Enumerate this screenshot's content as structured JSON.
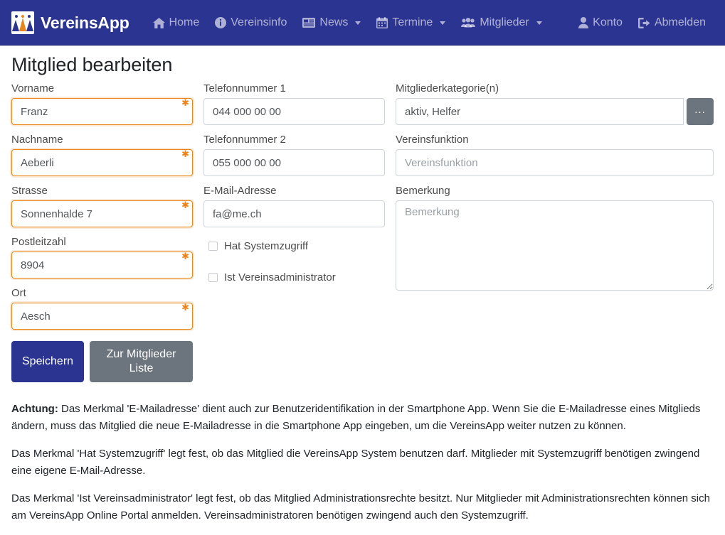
{
  "navbar": {
    "brand": "VereinsApp",
    "brand_icon": "vereinsapp-logo-icon",
    "items": [
      {
        "label": "Home",
        "icon": "home-icon",
        "caret": false
      },
      {
        "label": "Vereinsinfo",
        "icon": "info-circle-icon",
        "caret": false
      },
      {
        "label": "News",
        "icon": "newspaper-icon",
        "caret": true
      },
      {
        "label": "Termine",
        "icon": "calendar-icon",
        "caret": true
      },
      {
        "label": "Mitglieder",
        "icon": "users-icon",
        "caret": true
      }
    ],
    "right": [
      {
        "label": "Konto",
        "icon": "user-icon"
      },
      {
        "label": "Abmelden",
        "icon": "sign-out-icon"
      }
    ],
    "bg_color": "#2b3490"
  },
  "page": {
    "title": "Mitglied bearbeiten"
  },
  "form": {
    "required_marker": "✱",
    "column_left": [
      {
        "label": "Vorname",
        "value": "Franz",
        "required": true
      },
      {
        "label": "Nachname",
        "value": "Aeberli",
        "required": true
      },
      {
        "label": "Strasse",
        "value": "Sonnenhalde 7",
        "required": true
      },
      {
        "label": "Postleitzahl",
        "value": "8904",
        "required": true
      },
      {
        "label": "Ort",
        "value": "Aesch",
        "required": true
      }
    ],
    "column_middle": [
      {
        "label": "Telefonnummer 1",
        "value": "044 000 00 00"
      },
      {
        "label": "Telefonnummer 2",
        "value": "055 000 00 00"
      },
      {
        "label": "E-Mail-Adresse",
        "value": "fa@me.ch"
      }
    ],
    "checkboxes": [
      {
        "label": "Hat Systemzugriff",
        "checked": false
      },
      {
        "label": "Ist Vereinsadministrator",
        "checked": false
      }
    ],
    "category": {
      "label": "Mitgliederkategorie(n)",
      "value": "aktiv, Helfer",
      "button_label": "...",
      "button_name": "category-picker-button"
    },
    "function": {
      "label": "Vereinsfunktion",
      "value": "",
      "placeholder": "Vereinsfunktion"
    },
    "remark": {
      "label": "Bemerkung",
      "value": "",
      "placeholder": "Bemerkung"
    },
    "buttons": {
      "save": "Speichern",
      "list": "Zur Mitglieder Liste"
    }
  },
  "notes": {
    "warning_prefix": "Achtung:",
    "warning_text": " Das Merkmal 'E-Mailadresse' dient auch zur Benutzeridentifikation in der Smartphone App. Wenn Sie die E-Mailadresse eines Mitglieds ändern, muss das Mitglied die neue E-Mailadresse in die Smartphone App eingeben, um die VereinsApp weiter nutzen zu können.",
    "paragraph_2": "Das Merkmal 'Hat Systemzugriff' legt fest, ob das Mitglied die VereinsApp System benutzen darf. Mitglieder mit Systemzugriff benötigen zwingend eine eigene E-Mail-Adresse.",
    "paragraph_3": "Das Merkmal 'Ist Vereinsadministrator' legt fest, ob das Mitglied Administrationsrechte besitzt. Nur Mitglieder mit Administrationsrechten können sich am VereinsApp Online Portal anmelden. Vereinsadministratoren benötigen zwingend auch den Systemzugriff."
  }
}
